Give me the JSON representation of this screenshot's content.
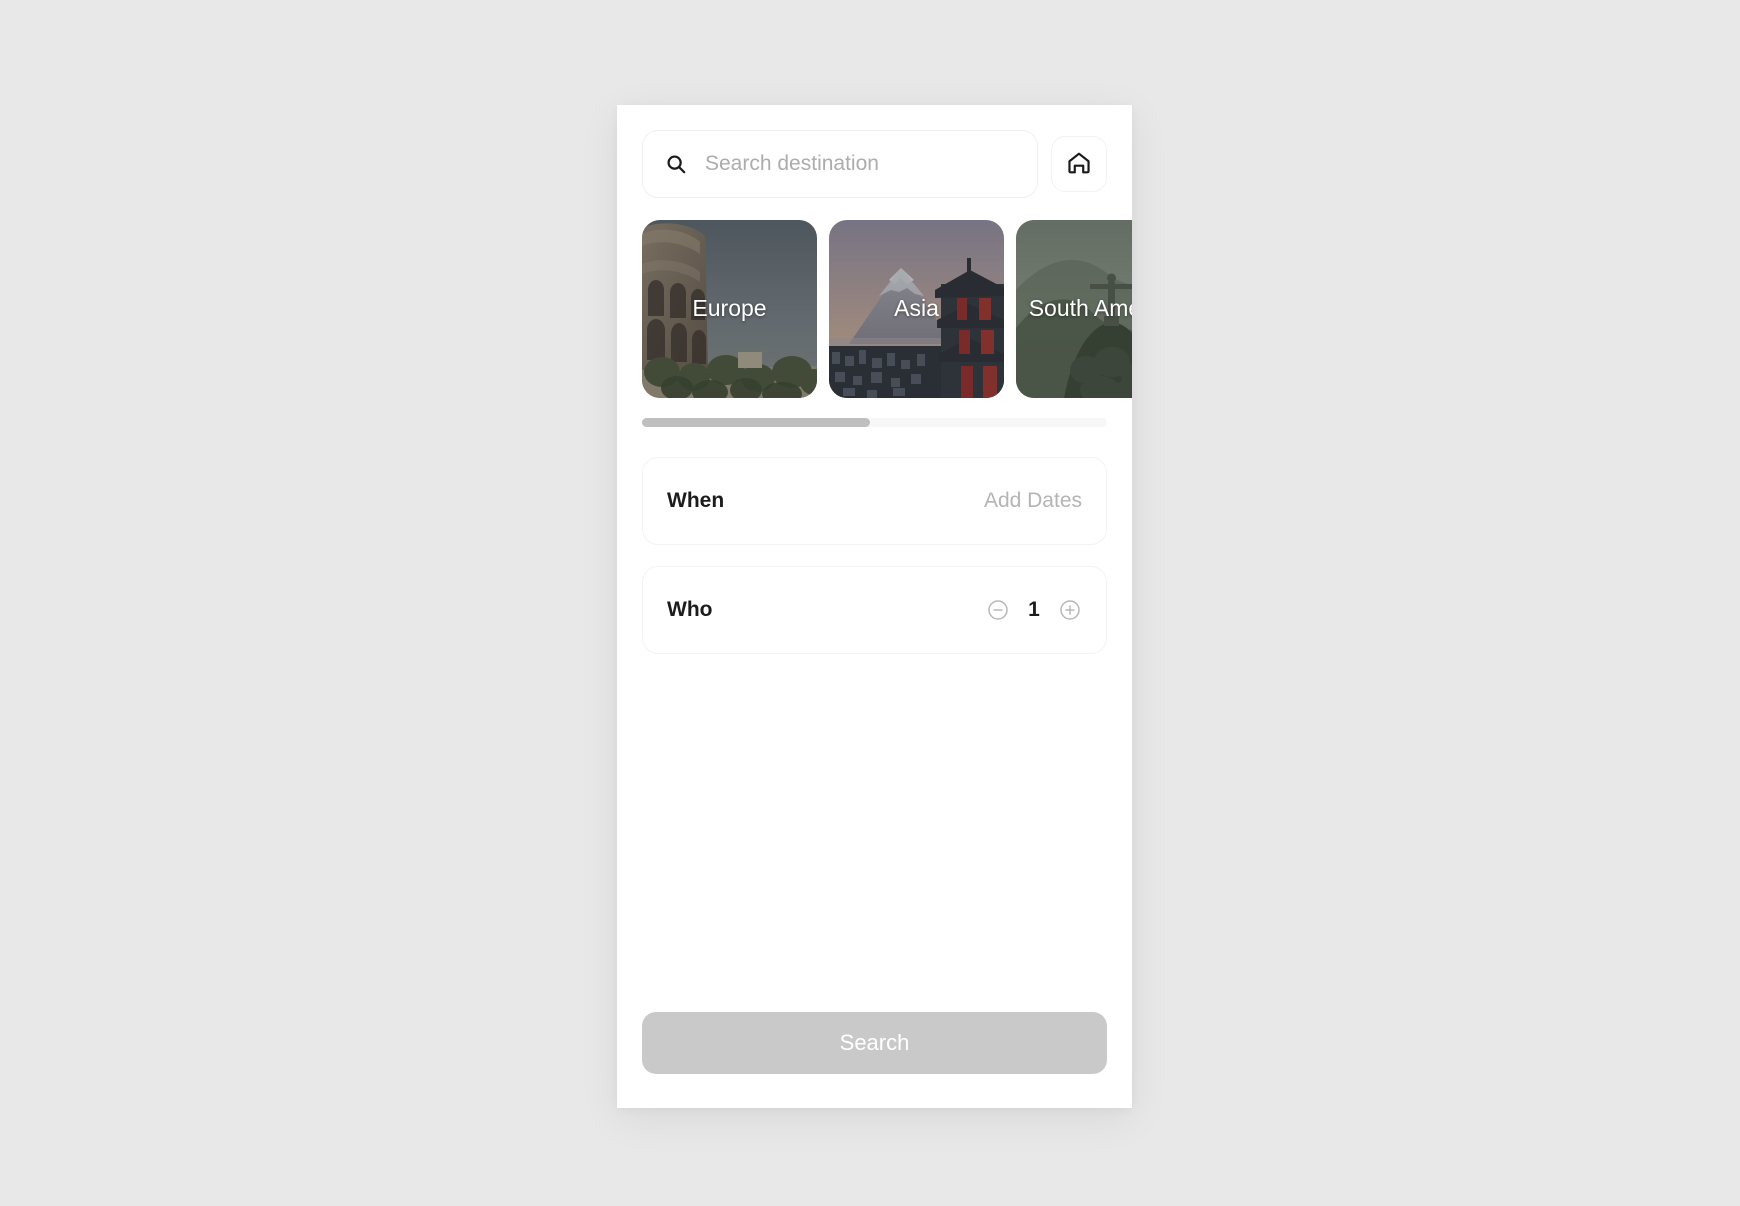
{
  "app": {
    "background_color": "#e8e8e8",
    "panel_color": "#ffffff"
  },
  "search": {
    "icon": "search-icon",
    "placeholder": "Search destination",
    "value": "",
    "home_icon": "home-icon"
  },
  "destinations": {
    "scroll_indicator": {
      "thumb_fraction": 0.49
    },
    "cards": [
      {
        "label": "Europe",
        "image": "colosseum-rome-photo",
        "accent": "#6d6256"
      },
      {
        "label": "Asia",
        "image": "mount-fuji-pagoda-photo",
        "accent": "#8f8794"
      },
      {
        "label": "South America",
        "image": "christ-the-redeemer-rio-photo",
        "accent": "#6f7a6a"
      }
    ]
  },
  "options": [
    {
      "name": "when",
      "label": "When",
      "value": "Add Dates"
    },
    {
      "name": "who",
      "label": "Who",
      "count": "1",
      "decrement_icon": "minus-circle-icon",
      "increment_icon": "plus-circle-icon"
    }
  ],
  "footer": {
    "search_label": "Search",
    "search_disabled_color": "#c9c9c9"
  }
}
